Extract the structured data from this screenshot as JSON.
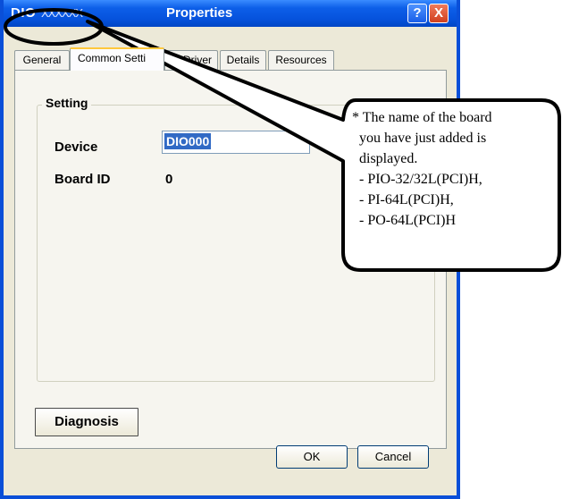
{
  "window": {
    "title_left": "DIO",
    "title_masked": "XXXXXX",
    "title_center": "Properties",
    "help_label": "?",
    "close_label": "X"
  },
  "tabs": [
    {
      "label": "General"
    },
    {
      "label": "Common Setti"
    },
    {
      "label": "Driver"
    },
    {
      "label": "Details"
    },
    {
      "label": "Resources"
    }
  ],
  "setting": {
    "group_title": "Setting",
    "device_label": "Device",
    "device_value": "DIO000",
    "board_id_label": "Board ID",
    "board_id_value": "0"
  },
  "buttons": {
    "diagnosis": "Diagnosis",
    "ok": "OK",
    "cancel": "Cancel"
  },
  "callout": {
    "lines": [
      "* The name of the board",
      "you have just added is",
      "displayed.",
      "- PIO-32/32L(PCI)H,",
      "- PI-64L(PCI)H,",
      "- PO-64L(PCI)H"
    ]
  }
}
